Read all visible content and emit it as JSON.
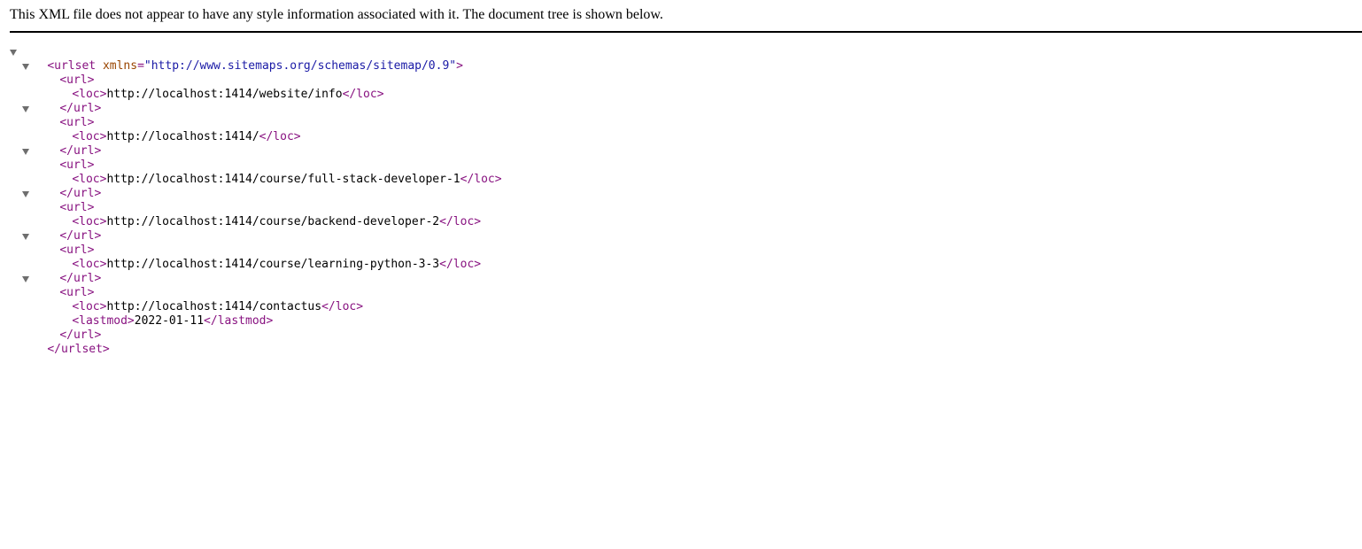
{
  "notice": "This XML file does not appear to have any style information associated with it. The document tree is shown below.",
  "root": {
    "open_tag": "<urlset",
    "attr_name": "xmlns",
    "attr_eq": "=",
    "attr_value": "\"http://www.sitemaps.org/schemas/sitemap/0.9\"",
    "open_close": ">",
    "close_tag": "</urlset>"
  },
  "url_open": "<url>",
  "url_close": "</url>",
  "loc_open": "<loc>",
  "loc_close": "</loc>",
  "lastmod_open": "<lastmod>",
  "lastmod_close": "</lastmod>",
  "urls": [
    {
      "loc": "http://localhost:1414/website/info"
    },
    {
      "loc": "http://localhost:1414/"
    },
    {
      "loc": "http://localhost:1414/course/full-stack-developer-1"
    },
    {
      "loc": "http://localhost:1414/course/backend-developer-2"
    },
    {
      "loc": "http://localhost:1414/course/learning-python-3-3"
    },
    {
      "loc": "http://localhost:1414/contactus",
      "lastmod": "2022-01-11"
    }
  ],
  "colors": {
    "tag": "#881280",
    "attr_name": "#994500",
    "attr_value": "#1a1aa6",
    "toggle": "#6e6e6e"
  }
}
